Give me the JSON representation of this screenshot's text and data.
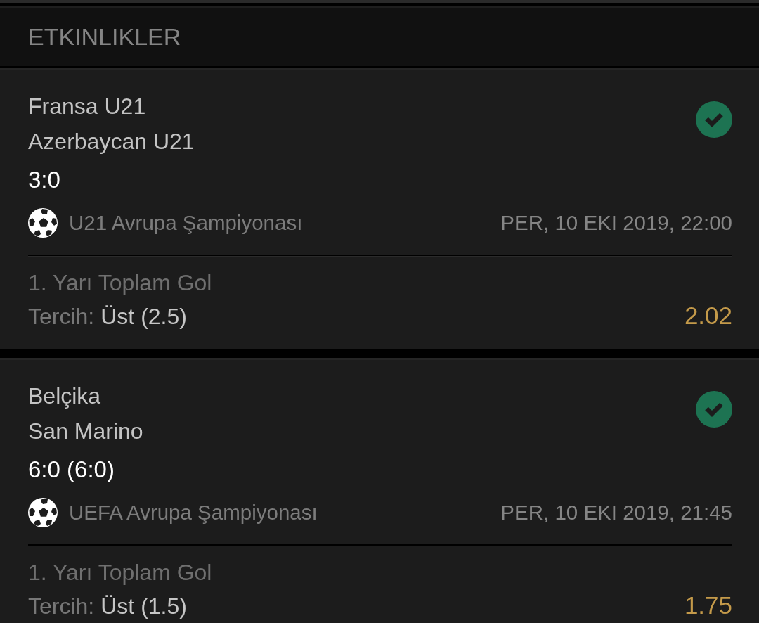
{
  "header": {
    "title": "ETKINLIKLER"
  },
  "events": [
    {
      "teams": [
        "Fransa U21",
        "Azerbaycan U21"
      ],
      "score": "3:0",
      "won": true,
      "league": "U21 Avrupa Şampiyonası",
      "date": "PER, 10 EKI 2019, 22:00",
      "market": "1. Yarı Toplam Gol",
      "pick_label": "Tercih:",
      "pick": "Üst (2.5)",
      "odds": "2.02"
    },
    {
      "teams": [
        "Belçika",
        "San Marino"
      ],
      "score": "6:0 (6:0)",
      "won": true,
      "league": "UEFA Avrupa Şampiyonası",
      "date": "PER, 10 EKI 2019, 21:45",
      "market": "1. Yarı Toplam Gol",
      "pick_label": "Tercih:",
      "pick": "Üst (1.5)",
      "odds": "1.75"
    }
  ]
}
